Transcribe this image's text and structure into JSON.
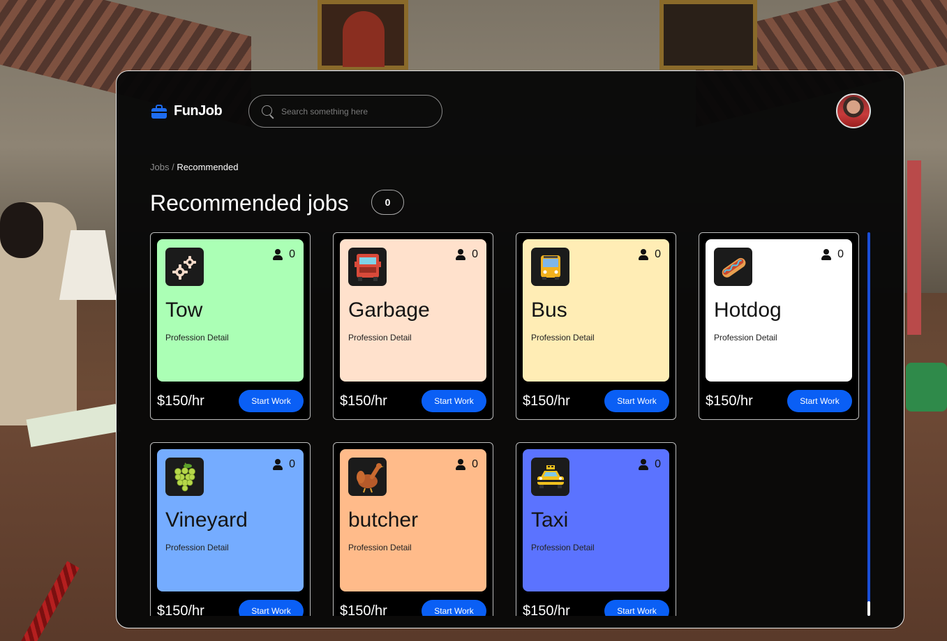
{
  "app": {
    "name": "FunJob"
  },
  "search": {
    "placeholder": "Search something here"
  },
  "breadcrumb": {
    "root": "Jobs",
    "separator": " / ",
    "current": "Recommended"
  },
  "page": {
    "title": "Recommended jobs",
    "count": "0"
  },
  "jobs": [
    {
      "name": "Tow",
      "detail": "Profession Detail",
      "workers": "0",
      "price": "$150/hr",
      "action": "Start Work",
      "color": "#abffb5",
      "icon": "gears-icon"
    },
    {
      "name": "Garbage",
      "detail": "Profession Detail",
      "workers": "0",
      "price": "$150/hr",
      "action": "Start Work",
      "color": "#ffe1cc",
      "icon": "garbage-truck-icon"
    },
    {
      "name": "Bus",
      "detail": "Profession Detail",
      "workers": "0",
      "price": "$150/hr",
      "action": "Start Work",
      "color": "#ffedb5",
      "icon": "bus-icon"
    },
    {
      "name": "Hotdog",
      "detail": "Profession Detail",
      "workers": "0",
      "price": "$150/hr",
      "action": "Start Work",
      "color": "#ffffff",
      "icon": "hotdog-icon"
    },
    {
      "name": "Vineyard",
      "detail": "Profession Detail",
      "workers": "0",
      "price": "$150/hr",
      "action": "Start Work",
      "color": "#75acff",
      "icon": "grapes-icon"
    },
    {
      "name": "butcher",
      "detail": "Profession Detail",
      "workers": "0",
      "price": "$150/hr",
      "action": "Start Work",
      "color": "#ffbb8a",
      "icon": "turkey-icon"
    },
    {
      "name": "Taxi",
      "detail": "Profession Detail",
      "workers": "0",
      "price": "$150/hr",
      "action": "Start Work",
      "color": "#5b73ff",
      "icon": "taxi-icon"
    }
  ],
  "colors": {
    "accent": "#0a5ff5",
    "panel": "#080808"
  }
}
